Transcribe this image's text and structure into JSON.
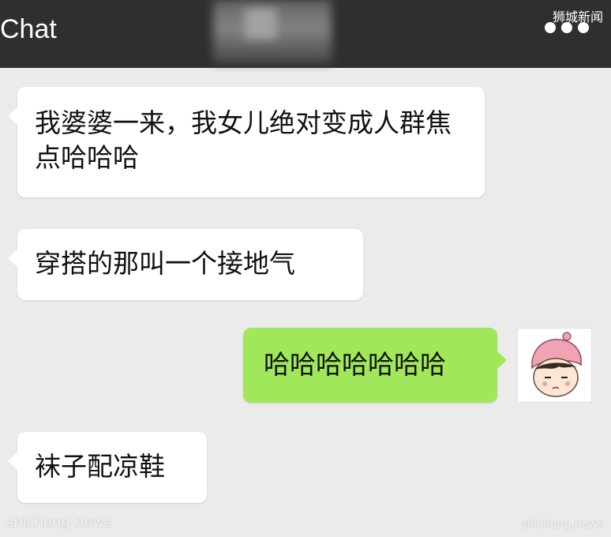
{
  "header": {
    "title": "Chat",
    "more_icon": "more-dots-icon",
    "background": "#2f2f2f"
  },
  "watermarks": {
    "top_right": "狮城新闻",
    "bottom_left": "shicheng news",
    "bottom_right": "shicheng.news"
  },
  "messages": [
    {
      "side": "left",
      "text": "我婆婆一来，我女儿绝对变成人群焦点哈哈哈",
      "bubble_color": "#ffffff"
    },
    {
      "side": "left",
      "text": "穿搭的那叫一个接地气",
      "bubble_color": "#ffffff"
    },
    {
      "side": "right",
      "text": "哈哈哈哈哈哈哈",
      "bubble_color": "#a0e75a"
    },
    {
      "side": "left",
      "text": "袜子配凉鞋",
      "bubble_color": "#ffffff"
    }
  ],
  "self_avatar": {
    "icon": "cartoon-girl-avatar-icon"
  },
  "colors": {
    "chat_background": "#ebebeb",
    "sent_bubble": "#a0e75a",
    "received_bubble": "#ffffff"
  }
}
